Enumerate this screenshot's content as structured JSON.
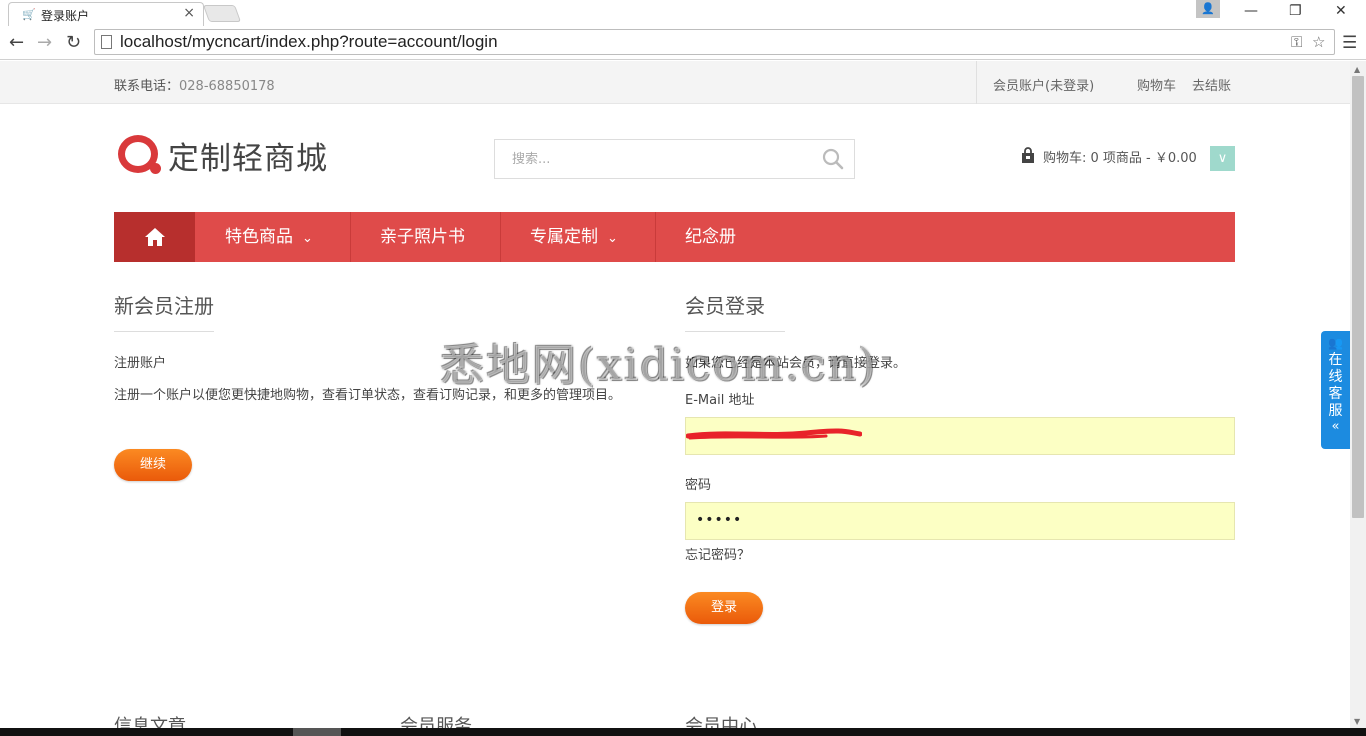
{
  "browser": {
    "tab_title": "登录账户",
    "url": "localhost/mycncart/index.php?route=account/login",
    "icons": {
      "favicon": "cart-icon",
      "back": "back-arrow-icon",
      "forward": "forward-arrow-icon",
      "reload": "reload-icon",
      "key": "key-icon",
      "star": "star-icon",
      "menu": "hamburger-icon"
    }
  },
  "topbar": {
    "phone_label": "联系电话：",
    "phone_number": "028-68850178",
    "account_link": "会员账户(未登录)",
    "cart_link": "购物车",
    "checkout_link": "去结账"
  },
  "header": {
    "logo_text": "定制轻商城",
    "search_placeholder": "搜索...",
    "cart_summary": "购物车: 0 项商品 - ￥0.00"
  },
  "nav": {
    "items": [
      {
        "label": "特色商品",
        "has_dropdown": true
      },
      {
        "label": "亲子照片书",
        "has_dropdown": false
      },
      {
        "label": "专属定制",
        "has_dropdown": true
      },
      {
        "label": "纪念册",
        "has_dropdown": false
      }
    ]
  },
  "register": {
    "title": "新会员注册",
    "subtitle": "注册账户",
    "description": "注册一个账户以便您更快捷地购物，查看订单状态，查看订购记录，和更多的管理项目。",
    "button": "继续"
  },
  "login": {
    "title": "会员登录",
    "intro": "如果您已经是本站会员，请直接登录。",
    "email_label": "E-Mail 地址",
    "password_label": "密码",
    "password_value": "•••••",
    "forgot": "忘记密码？",
    "button": "登录"
  },
  "watermark": "悉地网(xidicom.cn)",
  "kefu": {
    "label": "在线客服",
    "arrow": "«"
  },
  "footer": {
    "columns": [
      "信息文章",
      "会员服务",
      "会员中心"
    ]
  },
  "colors": {
    "brand_red": "#df4b4a",
    "home_red": "#b72f2d",
    "button_orange": "#f57014",
    "field_yellow": "#fcffc4",
    "kefu_blue": "#1c8be0",
    "cart_toggle": "#9fd9cc"
  }
}
